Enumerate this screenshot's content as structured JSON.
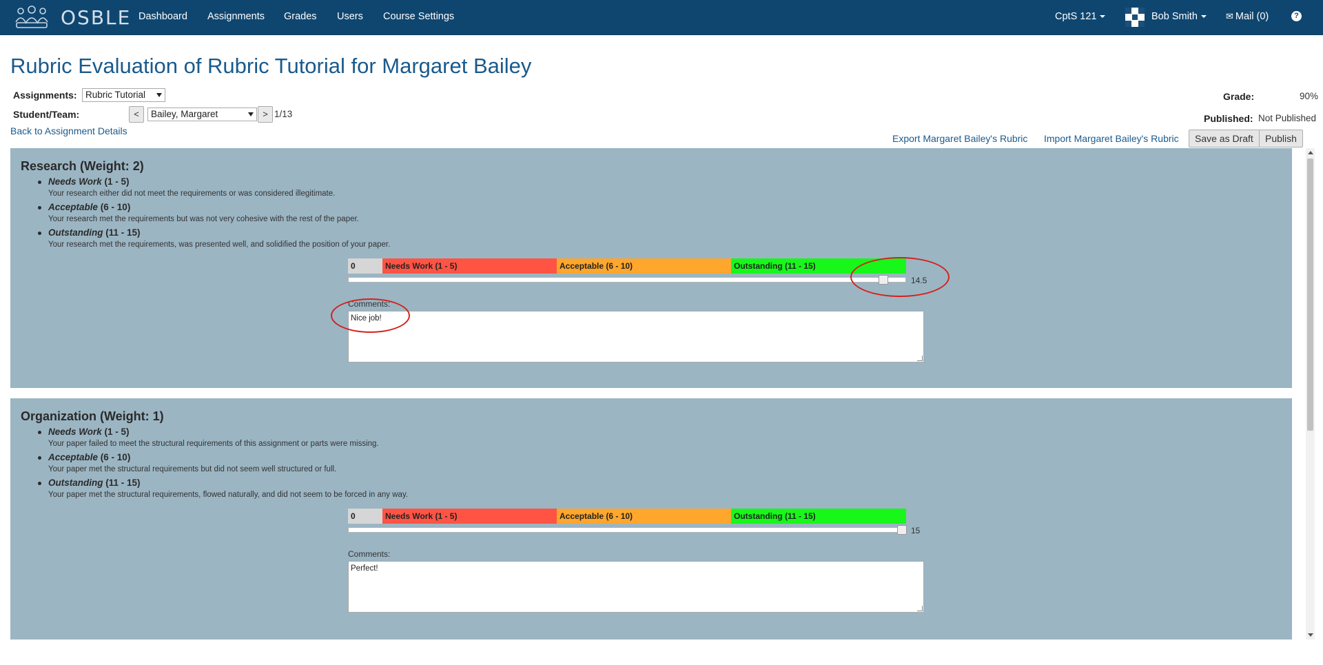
{
  "nav": {
    "brand": "OSBLE",
    "links": [
      "Dashboard",
      "Assignments",
      "Grades",
      "Users",
      "Course Settings"
    ],
    "course": "CptS 121",
    "user": "Bob Smith",
    "mail": "Mail (0)",
    "help": "?"
  },
  "header": {
    "title": "Rubric Evaluation of Rubric Tutorial for Margaret Bailey",
    "assignments_label": "Assignments:",
    "assignment_selected": "Rubric Tutorial",
    "student_label": "Student/Team:",
    "prev": "<",
    "student_selected": "Bailey, Margaret",
    "next": ">",
    "position": "1/13",
    "back_link": "Back to Assignment Details",
    "grade_label": "Grade:",
    "grade_value": "90%",
    "published_label": "Published:",
    "published_value": "Not Published",
    "export_link": "Export Margaret Bailey's Rubric",
    "import_link": "Import Margaret Bailey's Rubric",
    "save_draft": "Save as Draft",
    "publish": "Publish"
  },
  "criteria": [
    {
      "title": "Research (Weight: 2)",
      "levels": [
        {
          "name": "Needs Work",
          "range": "(1 - 5)",
          "desc": "Your research either did not meet the requirements or was considered illegitimate."
        },
        {
          "name": "Acceptable",
          "range": "(6 - 10)",
          "desc": "Your research met the requirements but was not very cohesive with the rest of the paper."
        },
        {
          "name": "Outstanding",
          "range": "(11 - 15)",
          "desc": "Your research met the requirements, was presented well, and solidified the position of your paper."
        }
      ],
      "scale": {
        "zero": "0",
        "needs_work": "Needs Work (1 - 5)",
        "acceptable": "Acceptable (6 - 10)",
        "outstanding": "Outstanding (11 - 15)"
      },
      "score": 14.5,
      "score_label": "14.5",
      "max_score": 15,
      "comments_label": "Comments:",
      "comment": "Nice job!"
    },
    {
      "title": "Organization (Weight: 1)",
      "levels": [
        {
          "name": "Needs Work",
          "range": "(1 - 5)",
          "desc": "Your paper failed to meet the structural requirements of this assignment or parts were missing."
        },
        {
          "name": "Acceptable",
          "range": "(6 - 10)",
          "desc": "Your paper met the structural requirements but did not seem well structured or full."
        },
        {
          "name": "Outstanding",
          "range": "(11 - 15)",
          "desc": "Your paper met the structural requirements, flowed naturally, and did not seem to be forced in any way."
        }
      ],
      "scale": {
        "zero": "0",
        "needs_work": "Needs Work (1 - 5)",
        "acceptable": "Acceptable (6 - 10)",
        "outstanding": "Outstanding (11 - 15)"
      },
      "score": 15,
      "score_label": "15",
      "max_score": 15,
      "comments_label": "Comments:",
      "comment": "Perfect!"
    }
  ]
}
